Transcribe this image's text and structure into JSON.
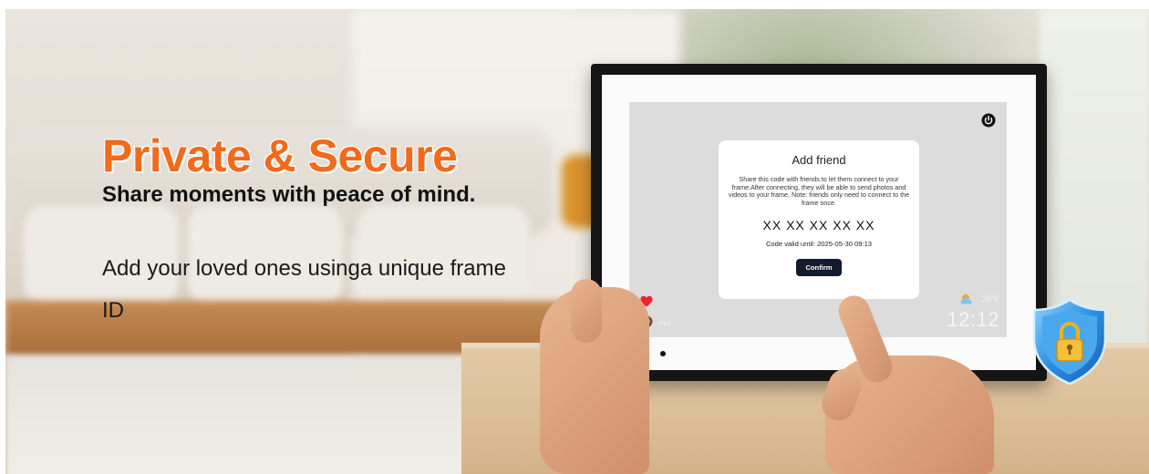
{
  "headline": {
    "title": "Private & Secure",
    "subtitle": "Share moments with peace of mind.",
    "body": "Add your loved ones usinga unique frame ID"
  },
  "frame_screen": {
    "dialog": {
      "title": "Add friend",
      "description": "Share this code with friends to let them connect to your frame.After connecting, they will be able to send photos and videos to your frame, Note: friends only need to connect to the frame once.",
      "code": "XX XX XX XX XX",
      "valid_until": "Code valid until: 2025-05-30 09:13",
      "confirm_label": "Confirm"
    },
    "user_label": "mini",
    "temperature": "26°F",
    "time": "12:12"
  },
  "icons": {
    "power": "power-icon",
    "heart": "heart-icon",
    "weather": "partly-cloudy-icon",
    "shield": "shield-lock-icon"
  },
  "colors": {
    "title_orange": "#f26a1b",
    "confirm_button": "#141b2d",
    "shield_blue": "#2b8fe0",
    "lock_gold": "#f3c13a"
  }
}
